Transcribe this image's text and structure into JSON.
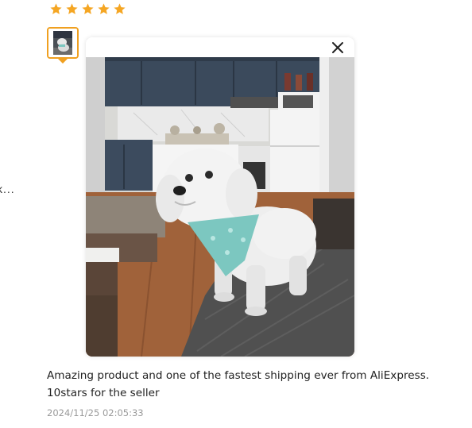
{
  "review": {
    "rating": 5,
    "rating_max": 5,
    "star_color": "#f5a623",
    "thumbnail_border_color": "#f0a020",
    "side_truncated_text": "k...",
    "text": "Amazing product and one of the fastest shipping ever from AliExpress. 10stars for the seller",
    "date": "2024/11/25 02:05:33"
  },
  "viewer": {
    "close_icon": "close-icon",
    "photo_description_icon": "photo-of-dog-with-bandana"
  }
}
